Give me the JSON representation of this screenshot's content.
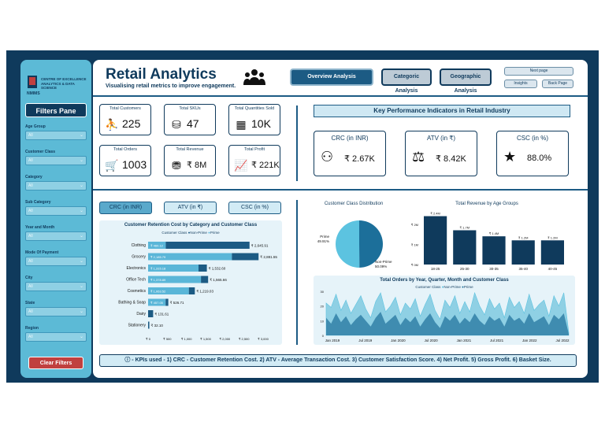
{
  "app": {
    "title": "Retail Analytics",
    "subtitle": "Visualising retail metrics to improve engagement.",
    "logo_org": "CENTRE OF EXCELLENCE",
    "logo_org2": "ANALYTICS & DATA SCIENCE",
    "logo_name": "NMIMS"
  },
  "nav": {
    "overview": "Overview Analysis",
    "categoric": "Categoric Analysis",
    "geographic": "Geographic Analysis",
    "next_page": "Next page",
    "insights": "Insights",
    "back_page": "Back Page"
  },
  "sidebar": {
    "pane_title": "Filters Pane",
    "filters": [
      {
        "label": "Age Group",
        "value": "All"
      },
      {
        "label": "Customer Class",
        "value": "All"
      },
      {
        "label": "Category",
        "value": "All"
      },
      {
        "label": "Sub Category",
        "value": "All"
      },
      {
        "label": "Year and Month",
        "value": "All"
      },
      {
        "label": "Mode Of Payment",
        "value": "All"
      },
      {
        "label": "City",
        "value": "All"
      },
      {
        "label": "State",
        "value": "All"
      },
      {
        "label": "Region",
        "value": "All"
      }
    ],
    "clear": "Clear Filters"
  },
  "kpis": [
    {
      "label": "Total Customers",
      "value": "225",
      "icon": "customer-icon"
    },
    {
      "label": "Total SKUs",
      "value": "47",
      "icon": "bottles-icon"
    },
    {
      "label": "Total Quantities Sold",
      "value": "10K",
      "icon": "boxes-icon"
    },
    {
      "label": "Total Orders",
      "value": "1003",
      "icon": "cart-icon"
    },
    {
      "label": "Total Revenue",
      "value": "₹ 8M",
      "icon": "coins-icon"
    },
    {
      "label": "Total Profit",
      "value": "₹ 221K",
      "icon": "growth-chart-icon"
    }
  ],
  "kpi_panel": {
    "heading": "Key Performance Indicators in Retail Industry",
    "items": [
      {
        "label": "CRC (in INR)",
        "value": "₹ 2.67K",
        "icon": "retention-icon"
      },
      {
        "label": "ATV (in ₹)",
        "value": "₹ 8.42K",
        "icon": "handshake-icon"
      },
      {
        "label": "CSC (in %)",
        "value": "88.0%",
        "icon": "rating-icon"
      }
    ]
  },
  "toggles": [
    "CRC (in INR)",
    "ATV (in ₹)",
    "CSC (in %)"
  ],
  "footer_note": "ⓘ - KPIs used - 1) CRC - Customer Retention Cost. 2) ATV - Average Transaction Cost. 3) Customer Satisfaction Score. 4) Net Profit. 5) Gross Profit. 6) Basket Size.",
  "chart_data": [
    {
      "type": "bar",
      "title": "Customer Retention Cost by Category and Customer Class",
      "legend_title": "Customer Class",
      "series": [
        {
          "name": "Non-Prime"
        },
        {
          "name": "Prime"
        }
      ],
      "categories": [
        "Clothing",
        "Grocery",
        "Electronics",
        "Office Tech",
        "Cosmetics",
        "Bathing & Soap",
        "Dairy",
        "Stationery"
      ],
      "prime": [
        460.12,
        2185.79,
        1315.18,
        1378.89,
        1063.52,
        457.05,
        null,
        null
      ],
      "prime_labels": [
        "₹ 460.12",
        "₹ 2,185.79",
        "₹ 1,315.18",
        "₹ 1,378.89",
        "₹ 1,063.52",
        "₹ 457.05",
        "",
        ""
      ],
      "totals": [
        2645.91,
        2881.55,
        1532.6,
        1565.66,
        1219.03,
        526.71,
        131.61,
        32.1
      ],
      "total_labels": [
        "₹ 2,645.91",
        "₹ 2,881.55",
        "₹ 1,532.60",
        "₹ 1,565.66",
        "₹ 1,219.03",
        "₹ 526.71",
        "₹ 131.61",
        "₹ 32.10"
      ],
      "xticks": [
        "₹ 0",
        "₹ 500",
        "₹ 1,000",
        "₹ 1,500",
        "₹ 2,000",
        "₹ 2,500",
        "₹ 3,000"
      ],
      "xlim": [
        0,
        3000
      ],
      "colors": {
        "prime": "#5ab6d8",
        "non_prime": "#1c5b84"
      }
    },
    {
      "type": "pie",
      "title": "Customer Class Distribution",
      "slices": [
        {
          "name": "Prime",
          "value": 49.91,
          "label": "Prime\n49.91%",
          "color": "#1c6f9a"
        },
        {
          "name": "Non-Prime",
          "value": 50.09,
          "label": "Non-Prime\n50.09%",
          "color": "#5cc3e0"
        }
      ]
    },
    {
      "type": "bar",
      "title": "Total Revenue by Age Groups",
      "categories": [
        "18-25",
        "25-30",
        "30-35",
        "35-40",
        "40-45"
      ],
      "values": [
        2.4,
        1.7,
        1.4,
        1.2,
        1.2
      ],
      "value_labels": [
        "₹ 2.4M",
        "₹ 1.7M",
        "₹ 1.4M",
        "₹ 1.2M",
        "₹ 1.2M"
      ],
      "yticks": [
        "₹ 0M",
        "₹ 1M",
        "₹ 2M"
      ],
      "ylim": [
        0,
        2.5
      ],
      "color": "#0f3a5c"
    },
    {
      "type": "area",
      "title": "Total Orders by Year, Quarter, Month and Customer Class",
      "legend_title": "Customer Class",
      "series_names": [
        "Non-Prime",
        "Prime"
      ],
      "xticks": [
        "Jan 2019",
        "Jul 2019",
        "Jan 2020",
        "Jul 2020",
        "Jan 2021",
        "Jul 2021",
        "Jan 2022",
        "Jul 2022"
      ],
      "yticks": [
        "0",
        "10",
        "20",
        "30"
      ],
      "ylim": [
        0,
        30
      ],
      "total": [
        22,
        19,
        28,
        17,
        24,
        15,
        21,
        27,
        18,
        12,
        23,
        29,
        16,
        20,
        26,
        14,
        22,
        18,
        25,
        13,
        21,
        28,
        17,
        11,
        24,
        19,
        27,
        15,
        23,
        16,
        29,
        20,
        14,
        25,
        18,
        22,
        12,
        26,
        19,
        23,
        15,
        28,
        17,
        21,
        24,
        13,
        27,
        20,
        29,
        2
      ],
      "prime": [
        12,
        8,
        15,
        9,
        13,
        7,
        11,
        14,
        10,
        6,
        12,
        16,
        8,
        11,
        14,
        7,
        12,
        9,
        13,
        6,
        11,
        15,
        9,
        5,
        13,
        10,
        14,
        8,
        12,
        9,
        15,
        10,
        7,
        13,
        10,
        12,
        6,
        14,
        10,
        12,
        8,
        15,
        9,
        11,
        13,
        7,
        14,
        11,
        15,
        1
      ]
    }
  ]
}
